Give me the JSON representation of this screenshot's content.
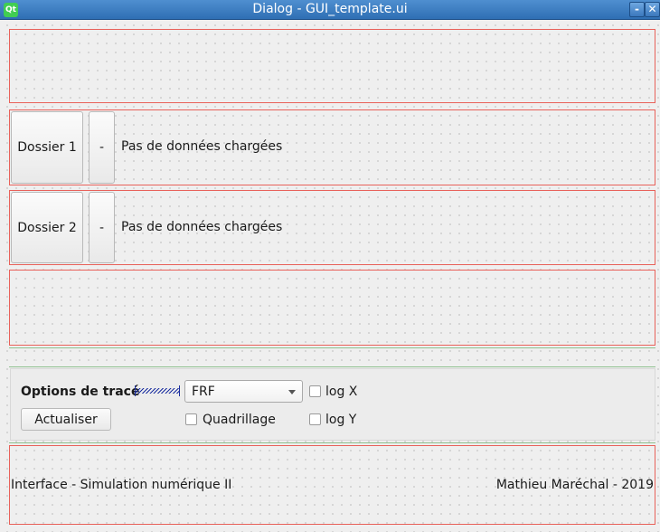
{
  "window": {
    "title": "Dialog - GUI_template.ui",
    "logo": "Qt",
    "minimize": "-",
    "close": "✕"
  },
  "folder1": {
    "button": "Dossier 1",
    "clear": "-",
    "status": "Pas de données chargées"
  },
  "folder2": {
    "button": "Dossier 2",
    "clear": "-",
    "status": "Pas de données chargées"
  },
  "options": {
    "title": "Options de tracé",
    "plot_type": "FRF",
    "log_x": "log X",
    "log_y": "log Y",
    "grid": "Quadrillage",
    "refresh": "Actualiser"
  },
  "footer": {
    "left": "Interface - Simulation numérique II",
    "right": "Mathieu Maréchal - 2019"
  }
}
